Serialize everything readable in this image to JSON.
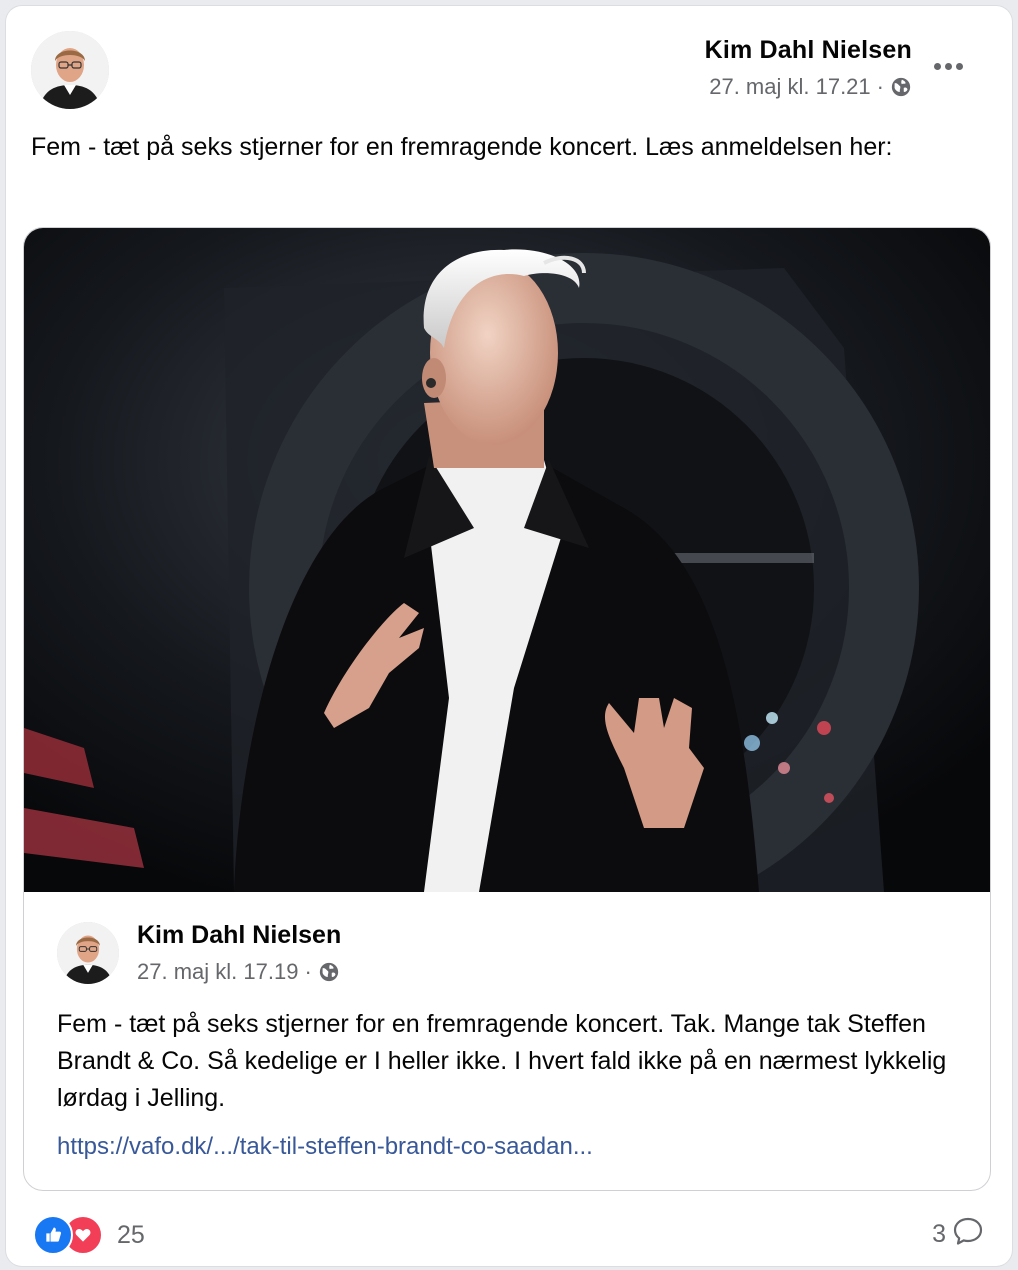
{
  "post": {
    "author": "Kim Dahl Nielsen",
    "timestamp": "27. maj kl. 17.21",
    "separator": "·",
    "audience_icon": "globe-icon",
    "more_icon": "more-options-icon",
    "text": "Fem - tæt på seks stjerner for en fremragende koncert. Læs anmeldelsen her:"
  },
  "shared_post": {
    "author": "Kim Dahl Nielsen",
    "timestamp": "27. maj kl. 17.19",
    "separator": "·",
    "audience_icon": "globe-icon",
    "text": "Fem - tæt på seks stjerner for en fremragende koncert. Tak. Mange tak Steffen Brandt & Co. Så kedelige er I heller ikke. I hvert fald ikke på en nærmest lykkelig lørdag i Jelling.",
    "link": "https://vafo.dk/.../tak-til-steffen-brandt-co-saadan...",
    "photo": "concert-photo"
  },
  "footer": {
    "reaction_icons": [
      "like-icon",
      "love-icon"
    ],
    "reaction_count": "25",
    "comment_count": "3",
    "comment_icon": "comment-icon"
  },
  "colors": {
    "like": "#1877f2",
    "love": "#f33e58",
    "link": "#385898",
    "meta": "#65676b"
  }
}
